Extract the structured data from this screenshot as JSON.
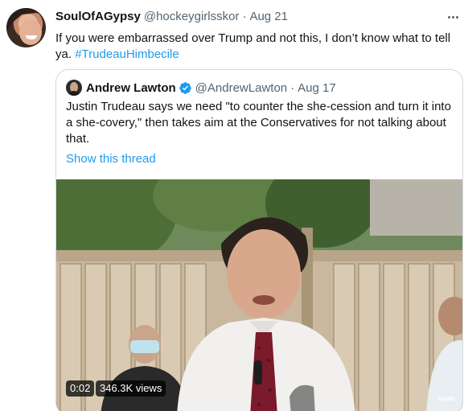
{
  "tweet": {
    "author_name": "SoulOfAGypsy",
    "author_handle": "@hockeygirlsskor",
    "separator": "·",
    "date": "Aug 21",
    "text": "If you were embarrassed over Trump and not this, I don’t know what to tell ya.",
    "hashtag": "#TrudeauHimbecile"
  },
  "quoted_tweet": {
    "author_name": "Andrew Lawton",
    "author_handle": "@AndrewLawton",
    "separator": "·",
    "date": "Aug 17",
    "verified": true,
    "text": "Justin Trudeau says we need \"to counter the she-cession and turn it into a she-covery,\" then takes aim at the Conservatives for not talking about that.",
    "show_thread_label": "Show this thread"
  },
  "video": {
    "timecode": "0:02",
    "views": "346.3K views",
    "watermark": "cpac"
  },
  "icons": {
    "more": "more-horizontal-icon",
    "verified": "verified-badge-icon"
  },
  "colors": {
    "link": "#1d9bf0",
    "secondary_text": "#536471",
    "border": "#cfd9de"
  }
}
